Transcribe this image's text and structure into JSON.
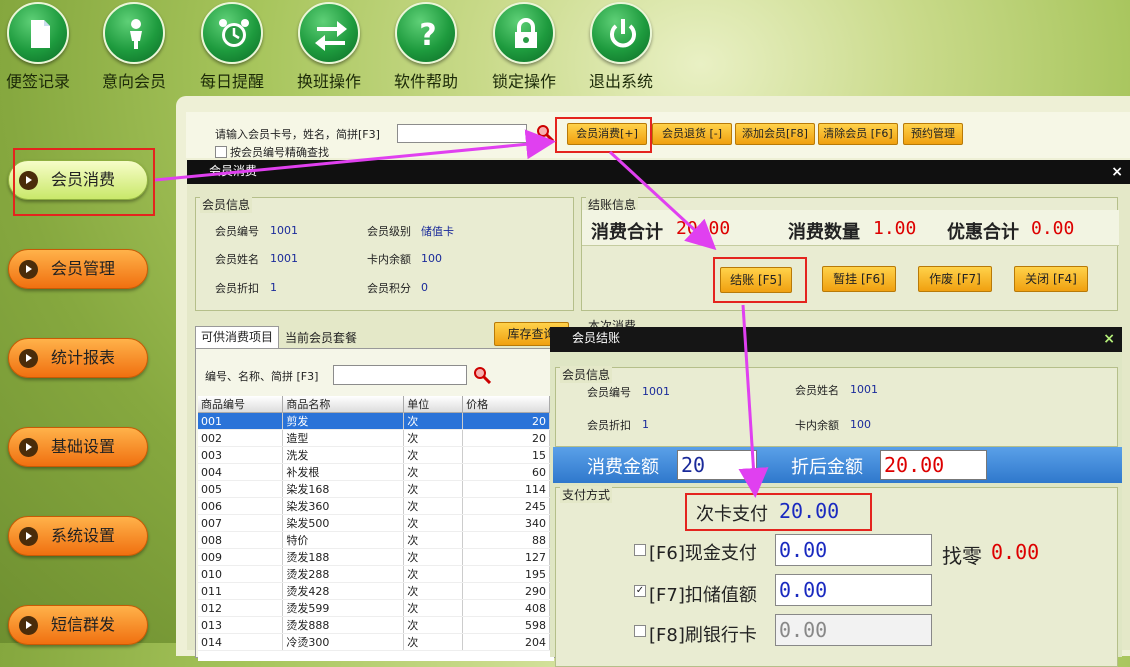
{
  "toolbar": [
    {
      "label": "便签记录",
      "icon": "memo-icon"
    },
    {
      "label": "意向会员",
      "icon": "person-icon"
    },
    {
      "label": "每日提醒",
      "icon": "alarm-clock-icon"
    },
    {
      "label": "换班操作",
      "icon": "swap-arrows-icon"
    },
    {
      "label": "软件帮助",
      "icon": "help-icon"
    },
    {
      "label": "锁定操作",
      "icon": "lock-icon"
    },
    {
      "label": "退出系统",
      "icon": "power-icon"
    }
  ],
  "sidebar": [
    {
      "label": "会员消费",
      "active": true
    },
    {
      "label": "会员管理"
    },
    {
      "label": "统计报表"
    },
    {
      "label": "基础设置"
    },
    {
      "label": "系统设置"
    },
    {
      "label": "短信群发"
    }
  ],
  "search": {
    "label": "请输入会员卡号，姓名，简拼[F3]",
    "value": "",
    "exact_label": "按会员编号精确查找"
  },
  "actions": [
    "会员消费[+]",
    "会员退货 [-]",
    "添加会员[F8]",
    "清除会员 [F6]",
    "预约管理"
  ],
  "consume_window": {
    "title": "会员消费",
    "member_group": "会员信息",
    "member": {
      "no_label": "会员编号",
      "no": "1001",
      "level_label": "会员级别",
      "level": "储值卡",
      "name_label": "会员姓名",
      "name": "1001",
      "balance_label": "卡内余额",
      "balance": "100",
      "discount_label": "会员折扣",
      "discount": "1",
      "points_label": "会员积分",
      "points": "0"
    },
    "checkout_group": "结账信息",
    "total_label": "消费合计",
    "total": "20.00",
    "qty_label": "消费数量",
    "qty": "1.00",
    "discount_total_label": "优惠合计",
    "discount_total": "0.00",
    "buttons": [
      "结账 [F5]",
      "暂挂 [F6]",
      "作废 [F7]",
      "关闭 [F4]"
    ],
    "current_label": "本次消费",
    "tabs": [
      "可供消费项目",
      "当前会员套餐"
    ],
    "stock_button": "库存查询",
    "item_search_label": "编号、名称、简拼 [F3]",
    "columns": [
      "商品编号",
      "商品名称",
      "单位",
      "价格"
    ],
    "rows": [
      [
        "001",
        "剪发",
        "次",
        "20"
      ],
      [
        "002",
        "造型",
        "次",
        "20"
      ],
      [
        "003",
        "洗发",
        "次",
        "15"
      ],
      [
        "004",
        "补发根",
        "次",
        "60"
      ],
      [
        "005",
        "染发168",
        "次",
        "114"
      ],
      [
        "006",
        "染发360",
        "次",
        "245"
      ],
      [
        "007",
        "染发500",
        "次",
        "340"
      ],
      [
        "008",
        "特价",
        "次",
        "88"
      ],
      [
        "009",
        "烫发188",
        "次",
        "127"
      ],
      [
        "010",
        "烫发288",
        "次",
        "195"
      ],
      [
        "011",
        "烫发428",
        "次",
        "290"
      ],
      [
        "012",
        "烫发599",
        "次",
        "408"
      ],
      [
        "013",
        "烫发888",
        "次",
        "598"
      ],
      [
        "014",
        "冷烫300",
        "次",
        "204"
      ]
    ]
  },
  "settle_window": {
    "title": "会员结账",
    "member_group": "会员信息",
    "no_label": "会员编号",
    "no": "1001",
    "name_label": "会员姓名",
    "name": "1001",
    "discount_label": "会员折扣",
    "discount": "1",
    "balance_label": "卡内余额",
    "balance": "100",
    "amount_label": "消费金额",
    "amount": "20",
    "after_label": "折后金额",
    "after": "20.00",
    "pay_group": "支付方式",
    "times_label": "次卡支付",
    "times_value": "20.00",
    "cash_label": "[F6]现金支付",
    "cash_value": "0.00",
    "change_label": "找零",
    "change_value": "0.00",
    "stored_label": "[F7]扣储值额",
    "stored_value": "0.00",
    "bank_label": "[F8]刷银行卡",
    "bank_value": "0.00"
  },
  "colors": {
    "accent_orange": "#f5a623",
    "highlight_red": "#e4241e",
    "arrow_magenta": "#e040f0",
    "selection_blue": "#2a73d8",
    "band_blue": "#3a86d9"
  }
}
